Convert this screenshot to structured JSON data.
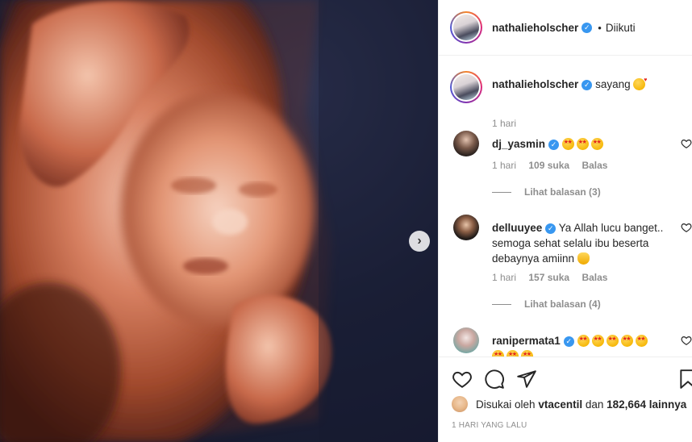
{
  "header": {
    "username": "nathalieholscher",
    "verified": true,
    "separator": "•",
    "follow_state": "Diikuti"
  },
  "caption": {
    "username": "nathalieholscher",
    "text": "sayang",
    "emoji": "kissing-heart-emoji",
    "time": "1 hari"
  },
  "comments": [
    {
      "username": "dj_yasmin",
      "text": "",
      "emoji_count": 3,
      "emoji": "star-struck-emoji",
      "time": "1 hari",
      "likes": "109 suka",
      "reply_label": "Balas",
      "view_replies": "Lihat balasan (3)"
    },
    {
      "username": "delluuyee",
      "text": "Ya Allah lucu banget.. semoga sehat selalu ibu beserta debaynya amiinn",
      "emoji": "raised-hands-emoji",
      "time": "1 hari",
      "likes": "157 suka",
      "reply_label": "Balas",
      "view_replies": "Lihat balasan (4)"
    },
    {
      "username": "ranipermata1",
      "text": "",
      "emoji_count": 8,
      "emoji": "star-struck-emoji"
    }
  ],
  "likes": {
    "prefix": "Disukai oleh",
    "user": "vtacentil",
    "and": "dan",
    "count": "182,664 lainnya"
  },
  "posted": "1 HARI YANG LALU",
  "colors": {
    "verified_blue": "#3897f0",
    "muted_text": "#8e8e8e",
    "divider": "#efefef"
  }
}
